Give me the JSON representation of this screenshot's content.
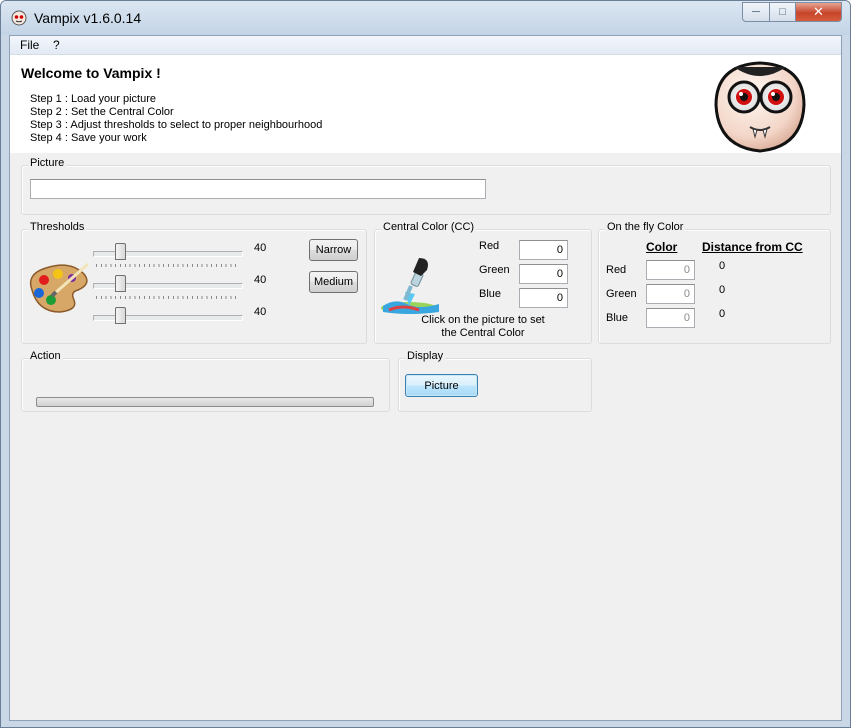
{
  "window": {
    "title": "Vampix v1.6.0.14"
  },
  "menu": {
    "file": "File",
    "help": "?"
  },
  "welcome": {
    "title": "Welcome to Vampix !",
    "steps": [
      "Step 1 : Load your picture",
      "Step 2 : Set the Central Color",
      "Step 3 : Adjust thresholds to select to proper neighbourhood",
      "Step 4 : Save your work"
    ]
  },
  "picture": {
    "label": "Picture",
    "path_value": ""
  },
  "thresholds": {
    "label": "Thresholds",
    "values": [
      "40",
      "40",
      "40"
    ],
    "slider_fraction": 0.16,
    "narrow_button": "Narrow",
    "medium_button": "Medium"
  },
  "central_color": {
    "label": "Central Color (CC)",
    "red_label": "Red",
    "green_label": "Green",
    "blue_label": "Blue",
    "red": "0",
    "green": "0",
    "blue": "0",
    "hint_line1": "Click on the picture to set",
    "hint_line2": "the Central Color"
  },
  "on_the_fly": {
    "label": "On the fly Color",
    "color_header": "Color",
    "distance_header": "Distance from CC",
    "red_label": "Red",
    "green_label": "Green",
    "blue_label": "Blue",
    "red": "0",
    "green": "0",
    "blue": "0",
    "red_distance": "0",
    "green_distance": "0",
    "blue_distance": "0"
  },
  "action": {
    "label": "Action",
    "progress": 0
  },
  "display": {
    "label": "Display",
    "picture_button": "Picture"
  },
  "colors": {
    "close_button": "#c7442a",
    "focus_border": "#3c7fb1"
  }
}
